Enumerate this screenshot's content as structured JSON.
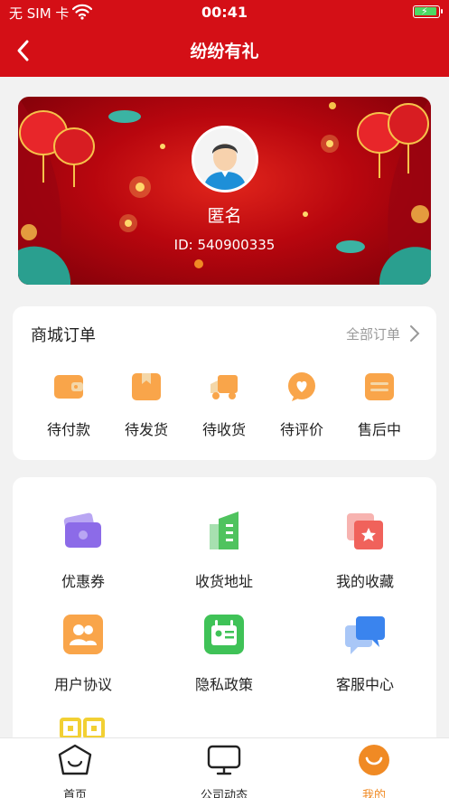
{
  "status_bar": {
    "carrier": "无 SIM 卡",
    "time": "00:41"
  },
  "nav": {
    "title": "纷纷有礼"
  },
  "profile": {
    "name": "匿名",
    "id": "ID: 540900335"
  },
  "orders": {
    "title": "商城订单",
    "all_label": "全部订单",
    "items": [
      {
        "label": "待付款",
        "icon": "wallet-icon"
      },
      {
        "label": "待发货",
        "icon": "package-icon"
      },
      {
        "label": "待收货",
        "icon": "truck-icon"
      },
      {
        "label": "待评价",
        "icon": "heart-chat-icon"
      },
      {
        "label": "售后中",
        "icon": "after-sale-icon"
      }
    ]
  },
  "services": [
    {
      "label": "优惠券",
      "icon": "coupon-icon"
    },
    {
      "label": "收货地址",
      "icon": "building-icon"
    },
    {
      "label": "我的收藏",
      "icon": "star-card-icon"
    },
    {
      "label": "用户协议",
      "icon": "users-icon"
    },
    {
      "label": "隐私政策",
      "icon": "id-card-icon"
    },
    {
      "label": "客服中心",
      "icon": "chat-bubbles-icon"
    }
  ],
  "tabs": [
    {
      "label": "首页",
      "icon": "home-icon"
    },
    {
      "label": "公司动态",
      "icon": "monitor-icon"
    },
    {
      "label": "我的",
      "icon": "smile-icon"
    }
  ],
  "colors": {
    "brand_red": "#d40f16",
    "accent_orange": "#f08a24"
  }
}
